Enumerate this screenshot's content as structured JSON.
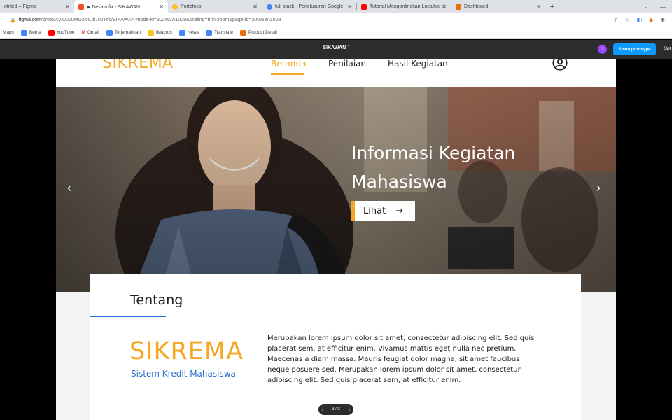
{
  "browser": {
    "tabs": [
      {
        "label": "ntitled – Figma",
        "color": "#888888"
      },
      {
        "label": "▶ Desain fix - SIKAWAN",
        "color": "#f24e1e"
      },
      {
        "label": "Portofolio",
        "color": "#f7c325"
      },
      {
        "label": "full stack - Penelusuran Google",
        "color": "#4285f4"
      },
      {
        "label": "Tutorial Mengonlinekan Localhost",
        "color": "#ff0000"
      },
      {
        "label": "Dashboard",
        "color": "#e8710a"
      }
    ],
    "url_host": "figma.com",
    "url_path": "/proto/XyXXluuMGzlcCol7rUTtfc/SIKAWAN?node-id=302%3A1009&scaling=min-zoom&page-id=300%3A1008",
    "bookmarks": [
      {
        "label": "Maps",
        "color": ""
      },
      {
        "label": "Berita",
        "color": "#4285f4"
      },
      {
        "label": "YouTube",
        "color": "#ff0000"
      },
      {
        "label": "Gmail",
        "color": "#ea4335"
      },
      {
        "label": "Terjemahkan",
        "color": "#4285f4"
      },
      {
        "label": "iMacros",
        "color": "#f7c325"
      },
      {
        "label": "News",
        "color": "#4285f4"
      },
      {
        "label": "Translate",
        "color": "#4285f4"
      },
      {
        "label": "Product Detail",
        "color": "#e8710a"
      }
    ]
  },
  "figma": {
    "title": "SIKAWAN ˇ",
    "user_initial": "G",
    "share_label": "Share prototype",
    "options_label": "Opt",
    "pager": {
      "label": "3 / 3",
      "prev": "‹",
      "next": "›"
    }
  },
  "site": {
    "logo": "SIKREMA",
    "nav": [
      {
        "label": "Beranda",
        "active": true
      },
      {
        "label": "Penilaian",
        "active": false
      },
      {
        "label": "Hasil Kegiatan",
        "active": false
      }
    ],
    "hero": {
      "title": "Informasi Kegiatan Mahasiswa",
      "button_label": "Lihat",
      "button_arrow": "→",
      "prev_arrow": "‹",
      "next_arrow": "›"
    },
    "about": {
      "title": "Tentang",
      "logo": "SIKREMA",
      "subtitle": "Sistem Kredit Mahasiswa",
      "body": "Merupakan lorem ipsum dolor sit amet, consectetur adipiscing elit. Sed quis placerat sem, at efficitur enim. Vivamus mattis eget nulla nec pretium. Maecenas a diam massa. Mauris feugiat dolor magna, sit amet faucibus neque posuere sed. Merupakan lorem ipsum dolor sit amet, consectetur adipiscing elit. Sed quis placerat sem, at efficitur enim."
    },
    "accent_color": "#f5a623",
    "link_color": "#2b6cd0"
  }
}
